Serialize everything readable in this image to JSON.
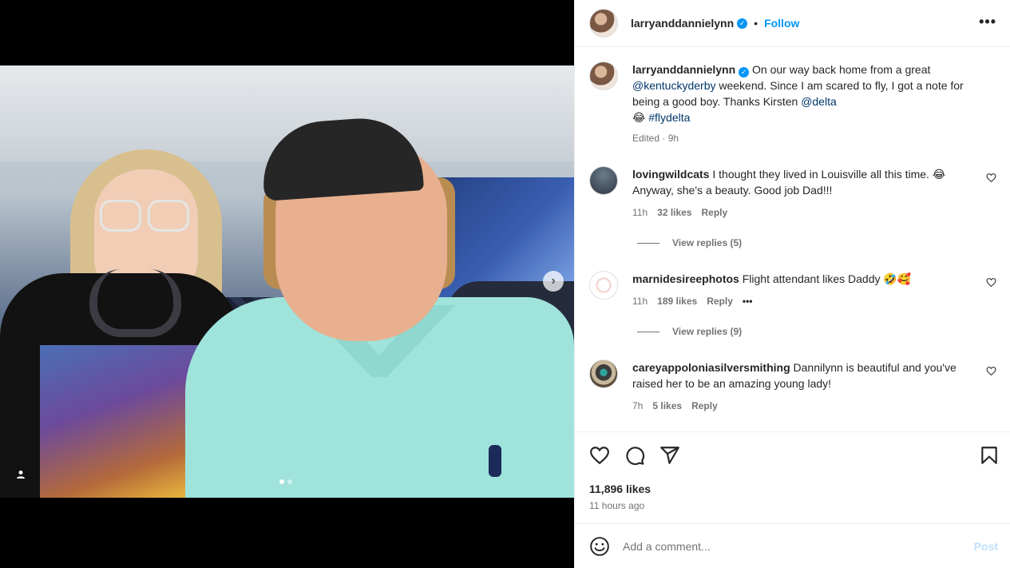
{
  "post": {
    "author": "larryanddannielynn",
    "follow_label": "Follow",
    "separator": "•",
    "more_label": "•••"
  },
  "caption": {
    "username": "larryanddannielynn",
    "text_part1": "On our way back home from a great",
    "mention1": "@kentuckyderby",
    "text_part2": "weekend. Since I am scared to fly, I got a note for being a good boy. Thanks Kirsten",
    "mention2": "@delta",
    "emoji": "😂",
    "hashtag": "#flydelta",
    "meta": "Edited · 9h"
  },
  "comments": [
    {
      "username": "lovingwildcats",
      "text": "I thought they lived in Louisville all this time. 😂 Anyway, she's a beauty. Good job Dad!!!",
      "time": "11h",
      "likes": "32 likes",
      "reply": "Reply",
      "view_replies": "View replies (5)"
    },
    {
      "username": "marnidesireephotos",
      "text": "Flight attendant likes Daddy 🤣🥰",
      "time": "11h",
      "likes": "189 likes",
      "reply": "Reply",
      "more": "•••",
      "view_replies": "View replies (9)"
    },
    {
      "username": "careyappoloniasilversmithing",
      "text": "Dannilynn is beautiful and you've raised her to be an amazing young lady!",
      "time": "7h",
      "likes": "5 likes",
      "reply": "Reply"
    }
  ],
  "stats": {
    "likes": "11,896 likes",
    "time_ago": "11 hours ago"
  },
  "composer": {
    "placeholder": "Add a comment...",
    "post_label": "Post"
  },
  "carousel": {
    "slide_count": 2,
    "active_index": 0
  },
  "colors": {
    "accent": "#0095f6",
    "link": "#00376b",
    "muted": "#737373"
  }
}
